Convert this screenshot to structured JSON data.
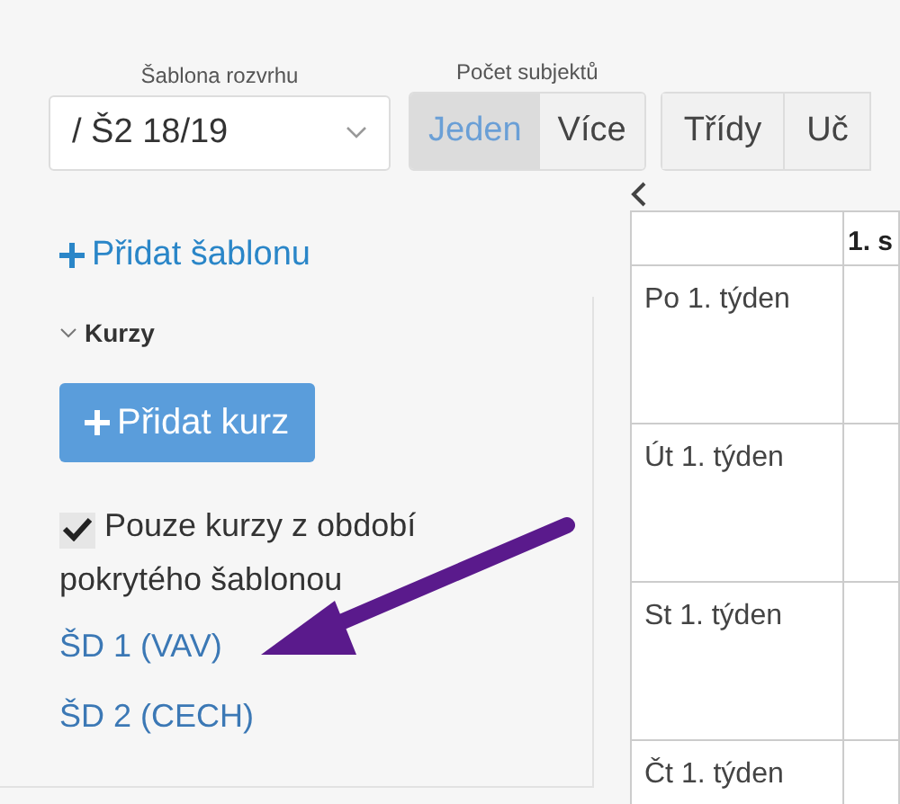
{
  "template": {
    "label": "Šablona rozvrhu",
    "value": "/ Š2 18/19"
  },
  "subject_count": {
    "label": "Počet subjektů",
    "options": [
      {
        "label": "Jeden",
        "selected": true
      },
      {
        "label": "Více",
        "selected": false
      }
    ]
  },
  "view_tabs": [
    {
      "label": "Třídy",
      "selected": false
    },
    {
      "label": "Uč",
      "selected": false
    }
  ],
  "add_template": "Přidat šablonu",
  "courses": {
    "title": "Kurzy",
    "expanded": true,
    "add_button": "Přidat kurz",
    "filter": {
      "label": "Pouze kurzy z období pokrytého šablonou",
      "checked": true
    },
    "items": [
      "ŠD 1 (VAV)",
      "ŠD 2 (CECH)"
    ]
  },
  "grid": {
    "header": "1. s",
    "rows": [
      "Po 1. týden",
      "Út 1. týden",
      "St 1. týden",
      "Čt 1. týden"
    ]
  }
}
